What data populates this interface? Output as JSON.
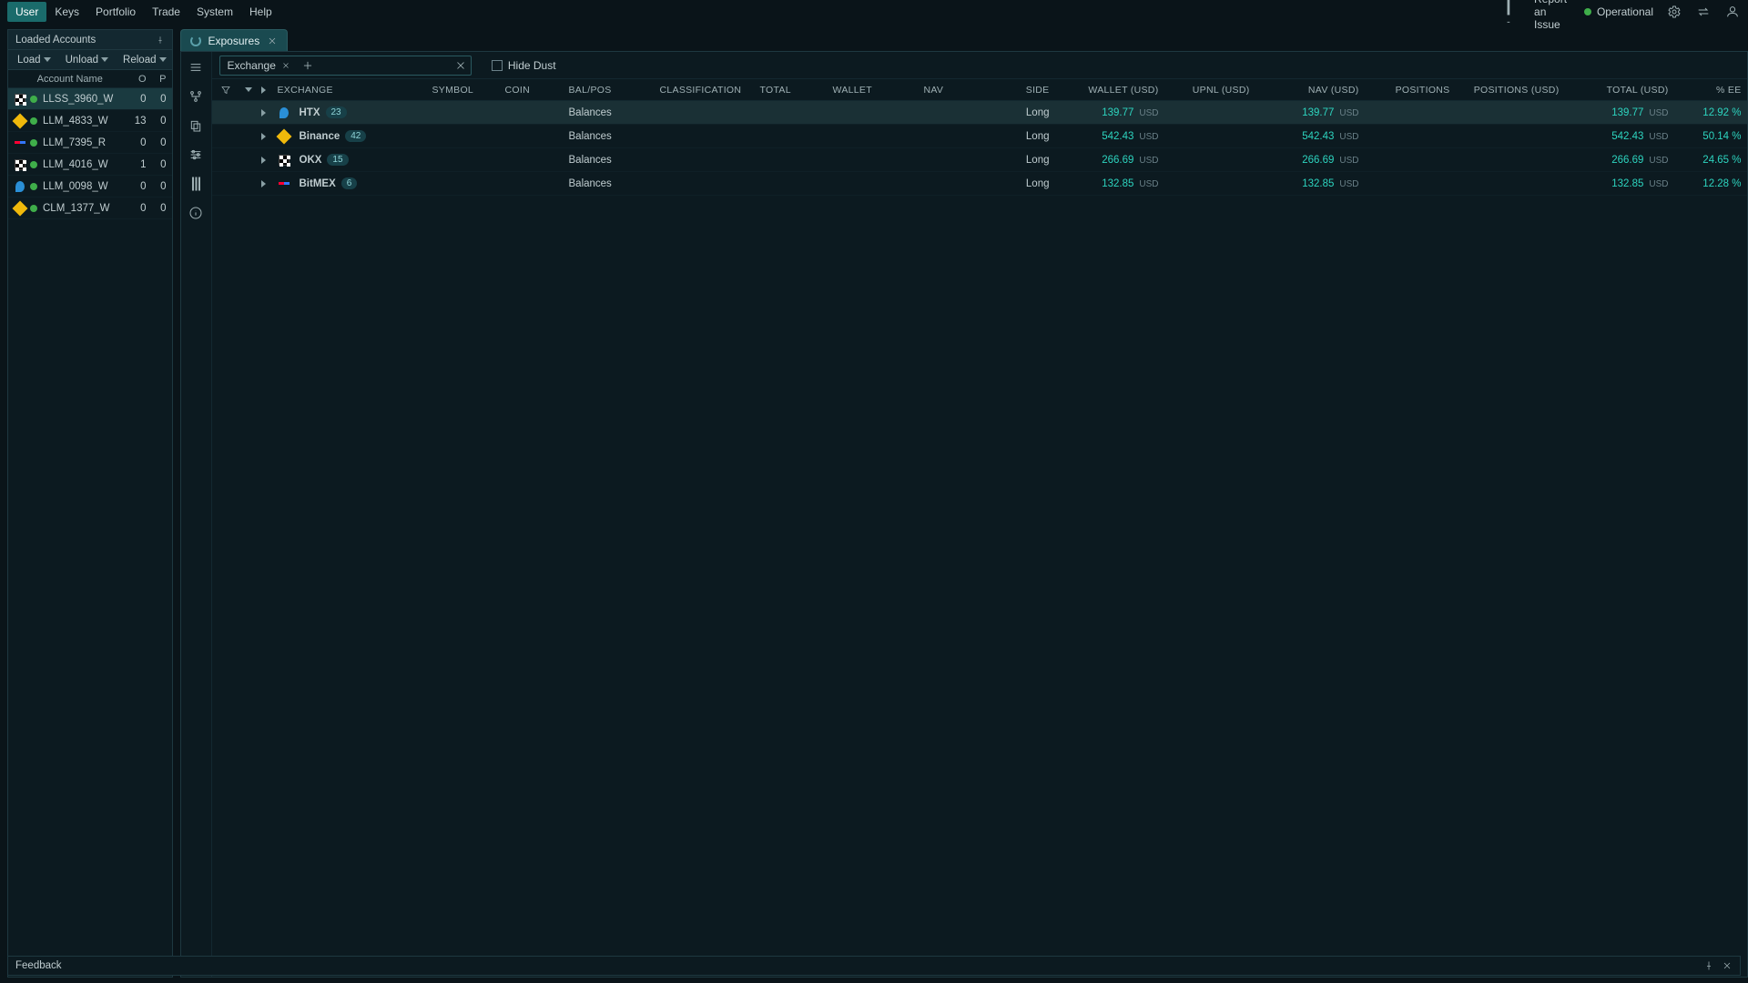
{
  "menu": {
    "items": [
      "User",
      "Keys",
      "Portfolio",
      "Trade",
      "System",
      "Help"
    ],
    "active": 0
  },
  "header_right": {
    "report": "Report an Issue",
    "status": "Operational"
  },
  "accounts_panel": {
    "title": "Loaded Accounts",
    "toolbar": [
      "Load",
      "Unload",
      "Reload"
    ],
    "cols": {
      "name": "Account Name",
      "o": "O",
      "p": "P"
    },
    "rows": [
      {
        "icon": "okx",
        "name": "LLSS_3960_W",
        "o": 0,
        "p": 0,
        "selected": true
      },
      {
        "icon": "binance",
        "name": "LLM_4833_W",
        "o": 13,
        "p": 0,
        "selected": false
      },
      {
        "icon": "bitmex",
        "name": "LLM_7395_R",
        "o": 0,
        "p": 0,
        "selected": false
      },
      {
        "icon": "okx",
        "name": "LLM_4016_W",
        "o": 1,
        "p": 0,
        "selected": false
      },
      {
        "icon": "htx",
        "name": "LLM_0098_W",
        "o": 0,
        "p": 0,
        "selected": false
      },
      {
        "icon": "binance",
        "name": "CLM_1377_W",
        "o": 0,
        "p": 0,
        "selected": false
      }
    ]
  },
  "tab": {
    "label": "Exposures"
  },
  "filter": {
    "chip": "Exchange",
    "hide_dust": "Hide Dust"
  },
  "grid": {
    "headers": [
      "",
      "",
      "EXCHANGE",
      "SYMBOL",
      "COIN",
      "BAL/POS",
      "CLASSIFICATION",
      "TOTAL",
      "WALLET",
      "NAV",
      "SIDE",
      "WALLET (USD)",
      "UPNL (USD)",
      "NAV (USD)",
      "POSITIONS",
      "POSITIONS (USD)",
      "TOTAL (USD)",
      "% EE"
    ],
    "rows": [
      {
        "icon": "htx",
        "exchange": "HTX",
        "badge": "23",
        "balpos": "Balances",
        "side": "Long",
        "wallet_usd": "139.77",
        "wallet_unit": "USD",
        "nav_usd": "139.77",
        "nav_unit": "USD",
        "total_usd": "139.77",
        "total_unit": "USD",
        "ee": "12.92 %"
      },
      {
        "icon": "binance",
        "exchange": "Binance",
        "badge": "42",
        "balpos": "Balances",
        "side": "Long",
        "wallet_usd": "542.43",
        "wallet_unit": "USD",
        "nav_usd": "542.43",
        "nav_unit": "USD",
        "total_usd": "542.43",
        "total_unit": "USD",
        "ee": "50.14 %"
      },
      {
        "icon": "okx",
        "exchange": "OKX",
        "badge": "15",
        "balpos": "Balances",
        "side": "Long",
        "wallet_usd": "266.69",
        "wallet_unit": "USD",
        "nav_usd": "266.69",
        "nav_unit": "USD",
        "total_usd": "266.69",
        "total_unit": "USD",
        "ee": "24.65 %"
      },
      {
        "icon": "bitmex",
        "exchange": "BitMEX",
        "badge": "6",
        "balpos": "Balances",
        "side": "Long",
        "wallet_usd": "132.85",
        "wallet_unit": "USD",
        "nav_usd": "132.85",
        "nav_unit": "USD",
        "total_usd": "132.85",
        "total_unit": "USD",
        "ee": "12.28 %"
      }
    ]
  },
  "feedback": {
    "label": "Feedback"
  }
}
